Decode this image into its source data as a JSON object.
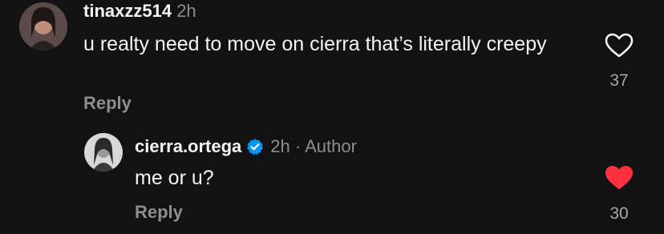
{
  "comments": [
    {
      "username": "tinaxzz514",
      "time": "2h",
      "text": "u realty need to move on cierra that’s literally creepy",
      "reply_label": "Reply",
      "like_count": "37",
      "liked": false,
      "avatar_icon": "profile-photo"
    },
    {
      "username": "cierra.ortega",
      "verified": true,
      "time": "2h · Author",
      "text": "me or u?",
      "reply_label": "Reply",
      "like_count": "30",
      "liked": true,
      "avatar_icon": "profile-photo"
    }
  ],
  "colors": {
    "background": "#121212",
    "text": "#f5f5f5",
    "muted": "#8e8e8e",
    "like_red": "#ff3040",
    "verified_blue": "#0095f6"
  }
}
